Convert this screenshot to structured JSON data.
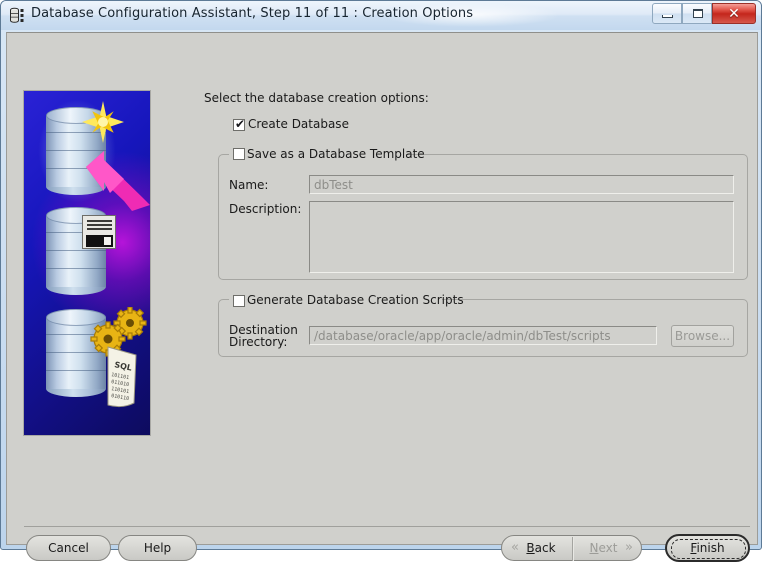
{
  "window": {
    "title": "Database Configuration Assistant, Step 11 of 11 : Creation Options",
    "app_icon": "database-icon",
    "controls": {
      "minimize": "minimize-icon",
      "maximize": "maximize-icon",
      "close": "✕"
    }
  },
  "main": {
    "intro": "Select the database creation options:",
    "create_database": {
      "label": "Create Database",
      "checked": true,
      "check_glyph": "✔"
    },
    "template_group": {
      "label": "Save as a Database Template",
      "checked": false,
      "name_label": "Name:",
      "name_value": "dbTest",
      "description_label": "Description:",
      "description_value": ""
    },
    "scripts_group": {
      "label": "Generate Database Creation Scripts",
      "checked": false,
      "dest_label_line1": "Destination",
      "dest_label_line2": "Directory:",
      "dest_value": "/database/oracle/app/oracle/admin/dbTest/scripts",
      "browse_label": "Browse..."
    }
  },
  "graphic": {
    "alt": "oracle-database-creation-illustration"
  },
  "footer": {
    "cancel_label": "Cancel",
    "help_label": "Help",
    "back_label": "Back",
    "back_mnemonic": "B",
    "back_chevron": "«",
    "next_label": "Next",
    "next_mnemonic": "N",
    "next_chevron": "»",
    "next_disabled": true,
    "finish_label": "Finish",
    "finish_mnemonic": "F"
  },
  "colors": {
    "titlebar": "#cfe0f2",
    "client_bg": "#d0d0cc",
    "close_button": "#c4261c",
    "graphic_blue": "#1616bb",
    "graphic_magenta": "#d914dc",
    "star_yellow": "#f5d020",
    "arrow_pink": "#ef2bb4",
    "disabled_text": "#8e8e8a"
  }
}
